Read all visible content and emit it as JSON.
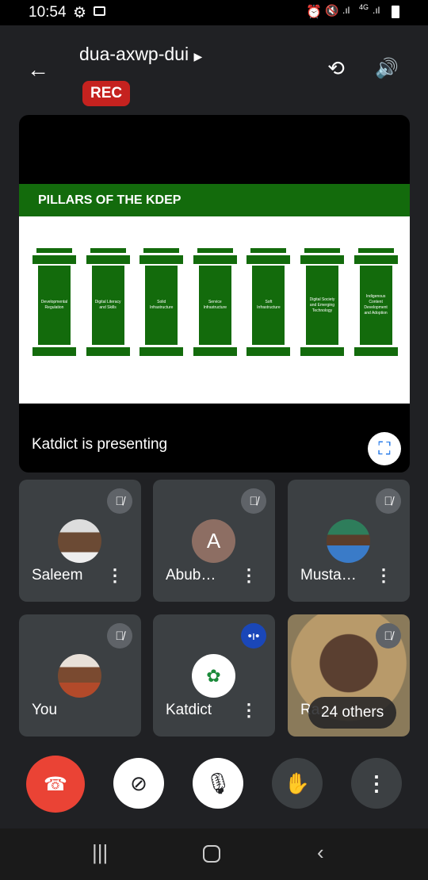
{
  "status_bar": {
    "time": "10:54",
    "icons": [
      "gear-icon",
      "video-icon",
      "alarm-icon",
      "mute-vibrate-icon",
      "signal-icon",
      "4g-icon",
      "signal-icon",
      "battery-icon"
    ],
    "network": "4G"
  },
  "header": {
    "meeting_code": "dua-axwp-dui",
    "rec_label": "REC",
    "rec_color": "#c5221f"
  },
  "presentation": {
    "slide_title": "PILLARS OF THE KDEP",
    "pillars": [
      "Developmental Regulation",
      "Digital Literacy and Skills",
      "Solid Infrastructure",
      "Service Infrastructure",
      "Soft Infrastructure",
      "Digital Society and Emerging Technology",
      "Indigenous Content Development and Adoption"
    ],
    "presenting_text": "Katdict is presenting",
    "slide_color": "#136b0c"
  },
  "participants": [
    {
      "name": "Saleem",
      "avatar": "photo",
      "muted": true
    },
    {
      "name": "Abub…",
      "avatar": "A",
      "avatar_color": "#8d6e63",
      "muted": true
    },
    {
      "name": "Musta…",
      "avatar": "photo",
      "muted": true
    },
    {
      "name": "You",
      "avatar": "photo",
      "muted": true
    },
    {
      "name": "Katdict",
      "avatar": "logo",
      "speaking": true
    },
    {
      "name": "Ra…",
      "avatar": "video",
      "muted": true,
      "overflow_label": "24 others"
    }
  ],
  "controls": [
    "end-call",
    "camera-off",
    "mic-off",
    "raise-hand",
    "more-options"
  ],
  "accent_colors": {
    "end_call": "#ea4335",
    "speaking": "#1a47b8"
  }
}
